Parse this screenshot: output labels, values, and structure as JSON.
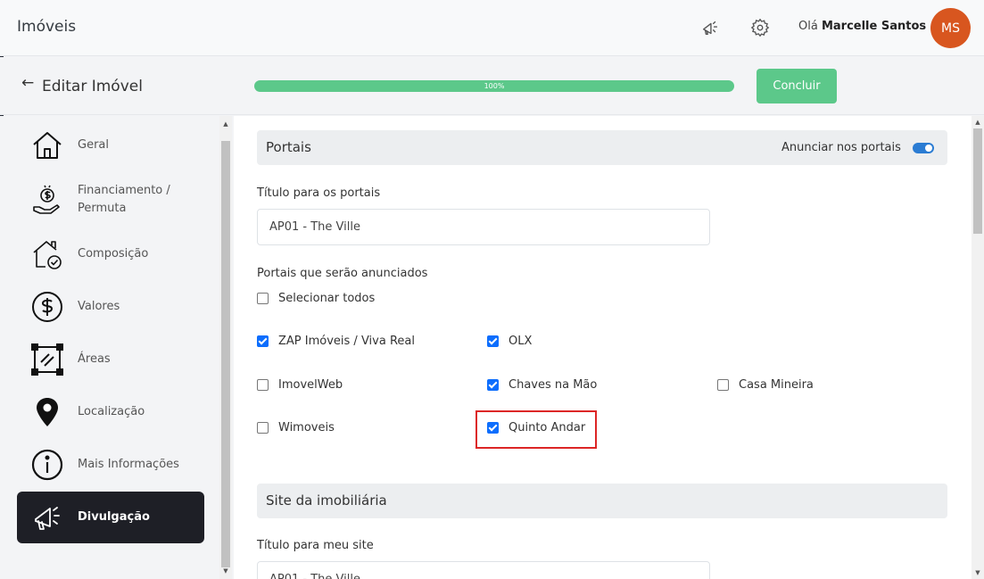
{
  "header": {
    "app_title": "Imóveis",
    "icons": [
      "megaphone-icon",
      "gear-icon"
    ],
    "greeting_prefix": "Olá",
    "user_name": "Marcelle Santos",
    "avatar_initials": "MS",
    "avatar_color": "#d8561f"
  },
  "toolbar": {
    "back_icon": "arrow-left-icon",
    "page_title": "Editar Imóvel",
    "progress_value": 1.0,
    "progress_label": "100%",
    "conclude_label": "Concluir",
    "accent_color": "#5cc88a"
  },
  "sidebar": {
    "items": [
      {
        "label": "Geral",
        "icon": "house-icon"
      },
      {
        "label": "Financiamento /\nPermuta",
        "icon": "money-hand-icon"
      },
      {
        "label": "Composição",
        "icon": "house-check-icon"
      },
      {
        "label": "Valores",
        "icon": "dollar-circle-icon"
      },
      {
        "label": "Áreas",
        "icon": "area-icon"
      },
      {
        "label": "Localização",
        "icon": "map-pin-icon"
      },
      {
        "label": "Mais Informações",
        "icon": "info-circle-icon"
      },
      {
        "label": "Divulgação",
        "icon": "megaphone-icon",
        "active": true
      }
    ],
    "active_color": "#1e1f26"
  },
  "portais": {
    "section_title": "Portais",
    "toggle_label": "Anunciar nos portais",
    "toggle_on": true,
    "title_label": "Título para os portais",
    "title_value": "AP01 - The Ville",
    "list_label": "Portais que serão anunciados",
    "select_all": {
      "label": "Selecionar todos",
      "checked": false
    },
    "options": [
      {
        "label": "ZAP Imóveis / Viva Real",
        "checked": true
      },
      {
        "label": "OLX",
        "checked": true
      },
      {
        "label": "ImovelWeb",
        "checked": false
      },
      {
        "label": "Chaves na Mão",
        "checked": true
      },
      {
        "label": "Casa Mineira",
        "checked": false
      },
      {
        "label": "Wimoveis",
        "checked": false
      },
      {
        "label": "Quinto Andar",
        "checked": true,
        "highlighted": true
      }
    ],
    "highlight_color": "#dc2626"
  },
  "site": {
    "section_title": "Site da imobiliária",
    "title_label": "Título para meu site",
    "title_value": "AP01 - The Ville"
  }
}
